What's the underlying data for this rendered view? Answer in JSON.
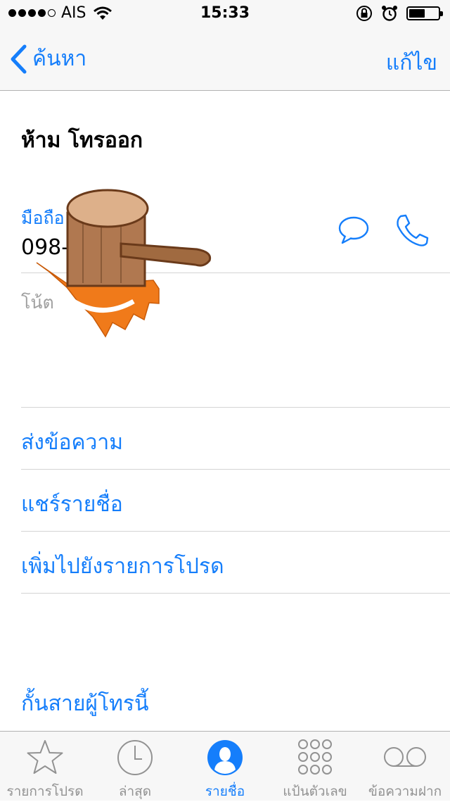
{
  "status_bar": {
    "carrier": "AIS",
    "time": "15:33",
    "battery_level": 0.55
  },
  "nav": {
    "back_label": "ค้นหา",
    "edit_label": "แก้ไข"
  },
  "contact": {
    "name": "ห้าม โทรออก",
    "phone_label": "มือถือ",
    "phone_number": "098-",
    "notes_label": "โน้ต"
  },
  "actions": {
    "send_message": "ส่งข้อความ",
    "share_contact": "แชร์รายชื่อ",
    "add_favorite": "เพิ่มไปยังรายการโปรด",
    "block_caller": "กั้นสายผู้โทรนี้"
  },
  "tabs": [
    {
      "label": "รายการโปรด",
      "icon": "star-icon"
    },
    {
      "label": "ล่าสุด",
      "icon": "clock-icon"
    },
    {
      "label": "รายชื่อ",
      "icon": "contacts-icon",
      "active": true
    },
    {
      "label": "แป้นตัวเลข",
      "icon": "keypad-icon"
    },
    {
      "label": "ข้อความฝาก",
      "icon": "voicemail-icon"
    }
  ],
  "colors": {
    "accent": "#157efb",
    "sticker_orange": "#f07a1a",
    "sticker_wood": "#b07850"
  }
}
